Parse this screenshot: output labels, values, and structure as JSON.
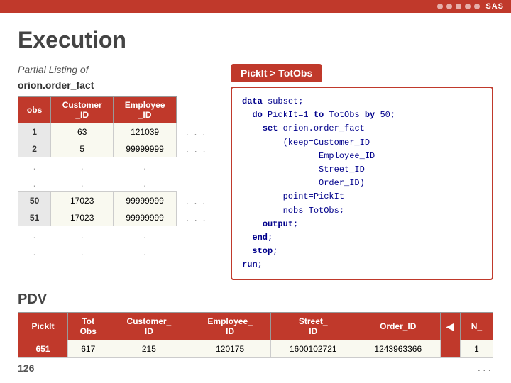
{
  "header": {
    "background_color": "#c0392b",
    "sas_label": "SAS"
  },
  "page": {
    "title": "Execution",
    "partial_listing_label": "Partial Listing of",
    "listing_title": "orion.order_fact"
  },
  "table": {
    "columns": [
      "obs",
      "Customer _ID",
      "Employee _ID",
      "..."
    ],
    "rows": [
      {
        "obs": "1",
        "customer_id": "63",
        "employee_id": "121039",
        "dots": "..."
      },
      {
        "obs": "2",
        "customer_id": "5",
        "employee_id": "99999999",
        "dots": "..."
      },
      {
        "obs": "50",
        "customer_id": "17023",
        "employee_id": "99999999",
        "dots": "..."
      },
      {
        "obs": "51",
        "customer_id": "17023",
        "employee_id": "99999999",
        "dots": "..."
      }
    ]
  },
  "badge": {
    "label": "PickIt > TotObs"
  },
  "code": {
    "lines": [
      "data subset;",
      "  do PickIt=1 to TotObs by 50;",
      "    set orion.order_fact",
      "        (keep=Customer_ID",
      "               Employee_ID",
      "               Street_ID",
      "               Order_ID)",
      "        point=PickIt",
      "        nobs=TotObs;",
      "    output;",
      "  end;",
      "  stop;",
      "run;"
    ]
  },
  "pdv": {
    "title": "PDV",
    "columns": [
      "PickIt",
      "Tot Obs",
      "Customer_ ID",
      "Employee_ ID",
      "Street_ ID",
      "Order_ID",
      "",
      "N_"
    ],
    "row": {
      "pickit": "651",
      "tot_obs": "617",
      "customer_id": "215",
      "employee_id": "120175",
      "street_id": "1600102721",
      "order_id": "1243963366",
      "blank": "",
      "n": "1"
    }
  },
  "footer": {
    "page_number": "126",
    "dots": "..."
  }
}
